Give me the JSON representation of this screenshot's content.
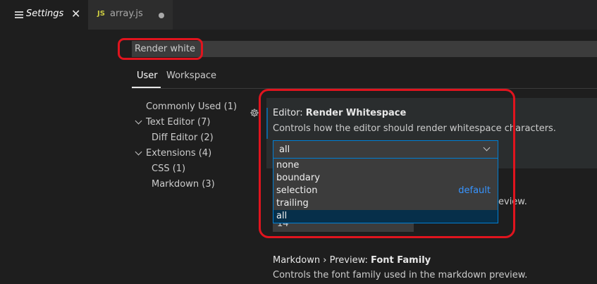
{
  "tabs": [
    {
      "label": "Settings",
      "icon": "settings-list-icon",
      "close": "✕"
    },
    {
      "label": "array.js",
      "icon_text": "JS",
      "dirty": true
    }
  ],
  "search": {
    "value": "Render white"
  },
  "scope_tabs": {
    "user": "User",
    "workspace": "Workspace"
  },
  "toc": [
    {
      "label": "Commonly Used (1)"
    },
    {
      "label": "Text Editor (7)",
      "expanded": true
    },
    {
      "label": "Diff Editor (2)"
    },
    {
      "label": "Extensions (4)",
      "expanded": true
    },
    {
      "label": "CSS (1)"
    },
    {
      "label": "Markdown (3)"
    }
  ],
  "setting_render_whitespace": {
    "category": "Editor: ",
    "name": "Render Whitespace",
    "description": "Controls how the editor should render whitespace characters.",
    "value": "all",
    "options": [
      "none",
      "boundary",
      "selection",
      "trailing",
      "all"
    ],
    "default_label": "default",
    "default_option": "selection"
  },
  "setting_tab_size": {
    "value": "14",
    "desc_peek": "eview."
  },
  "setting_markdown_font": {
    "category": "Markdown › Preview: ",
    "name": "Font Family",
    "description": "Controls the font family used in the markdown preview."
  },
  "colors": {
    "accent": "#007fd4",
    "callout": "#e0141e",
    "default_link": "#3794ff"
  }
}
